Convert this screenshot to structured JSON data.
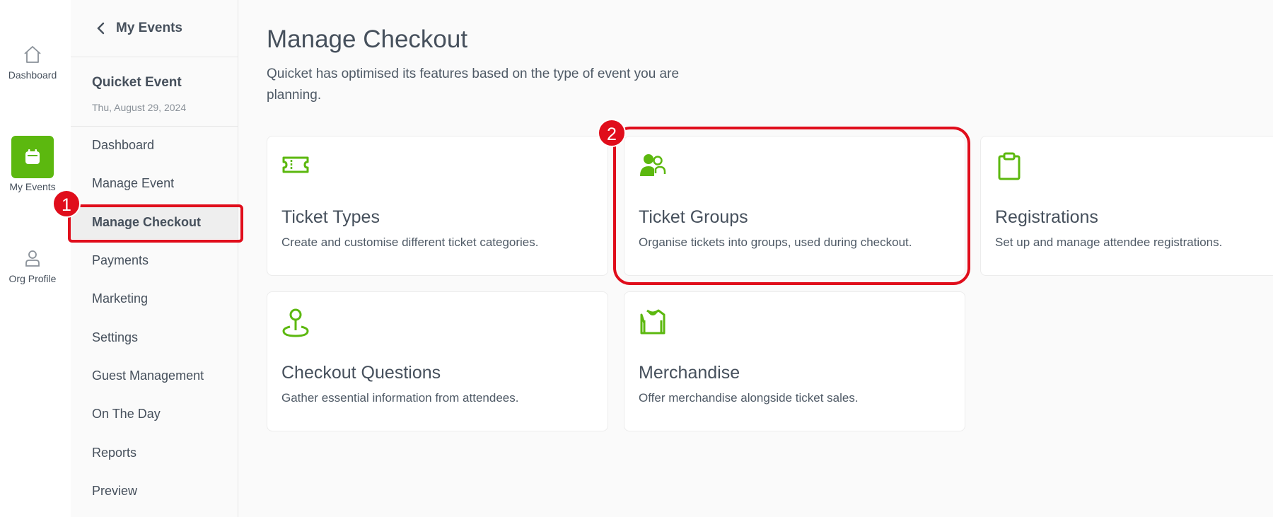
{
  "rail": {
    "items": [
      {
        "label": "Dashboard",
        "icon": "home-icon"
      },
      {
        "label": "My Events",
        "icon": "calendar-icon"
      },
      {
        "label": "Org Profile",
        "icon": "user-icon"
      }
    ]
  },
  "subnav": {
    "back_label": "My Events",
    "event_name": "Quicket Event",
    "event_date": "Thu, August 29, 2024",
    "items": [
      {
        "label": "Dashboard"
      },
      {
        "label": "Manage Event"
      },
      {
        "label": "Manage Checkout"
      },
      {
        "label": "Payments"
      },
      {
        "label": "Marketing"
      },
      {
        "label": "Settings"
      },
      {
        "label": "Guest Management"
      },
      {
        "label": "On The Day"
      },
      {
        "label": "Reports"
      },
      {
        "label": "Preview"
      }
    ]
  },
  "main": {
    "title": "Manage Checkout",
    "description": "Quicket has optimised its features based on the type of event you are planning.",
    "cards": [
      {
        "title": "Ticket Types",
        "desc": "Create and customise different ticket categories.",
        "icon": "ticket-icon"
      },
      {
        "title": "Ticket Groups",
        "desc": "Organise tickets into groups, used during checkout.",
        "icon": "user-group-icon"
      },
      {
        "title": "Registrations",
        "desc": "Set up and manage attendee registrations.",
        "icon": "clipboard-icon"
      },
      {
        "title": "Checkout Questions",
        "desc": "Gather essential information from attendees.",
        "icon": "location-pin-icon"
      },
      {
        "title": "Merchandise",
        "desc": "Offer merchandise alongside ticket sales.",
        "icon": "shirt-icon"
      }
    ]
  },
  "annotations": {
    "badge1": "1",
    "badge2": "2"
  },
  "colors": {
    "accent": "#5cb80f",
    "highlight": "#e00d1b",
    "text": "#46505c"
  }
}
